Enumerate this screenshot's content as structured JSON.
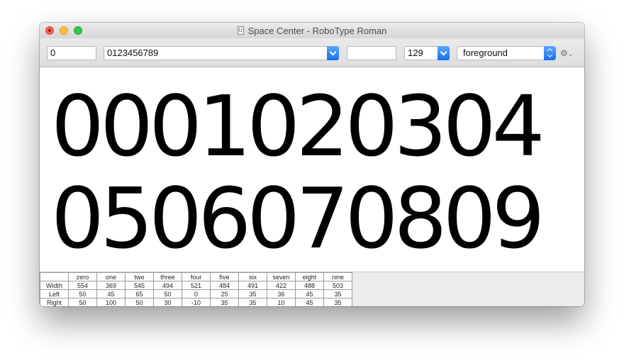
{
  "window": {
    "title": "Space Center - RoboType Roman",
    "title_icon": "document-icon",
    "title_icon_glyph": "U"
  },
  "toolbar": {
    "prefix_value": "0",
    "text_value": "0123456789",
    "suffix_value": "",
    "size_value": "129",
    "layer_value": "foreground",
    "settings_icon": "gear-icon"
  },
  "preview": {
    "line1": "0001020304",
    "line2": "0506070809"
  },
  "metrics": {
    "headers": [
      "",
      "zero",
      "one",
      "two",
      "three",
      "four",
      "five",
      "six",
      "seven",
      "eight",
      "nine"
    ],
    "rows": [
      {
        "label": "Width",
        "values": [
          "554",
          "369",
          "545",
          "494",
          "521",
          "484",
          "491",
          "422",
          "488",
          "503"
        ]
      },
      {
        "label": "Left",
        "values": [
          "50",
          "45",
          "65",
          "50",
          "0",
          "25",
          "35",
          "36",
          "45",
          "35"
        ]
      },
      {
        "label": "Right",
        "values": [
          "50",
          "100",
          "50",
          "30",
          "-10",
          "35",
          "35",
          "10",
          "45",
          "35"
        ]
      }
    ]
  },
  "colors": {
    "close": "#fc605c",
    "minimize": "#fdbc40",
    "maximize": "#34c84a",
    "accent": "#1372ee"
  }
}
